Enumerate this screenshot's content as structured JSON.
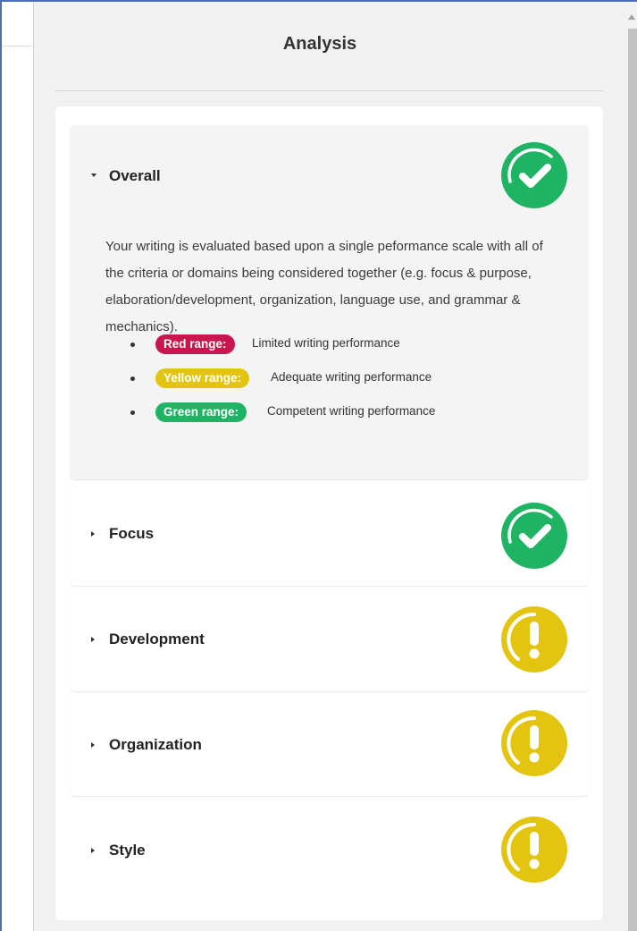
{
  "panel": {
    "title": "Analysis"
  },
  "sections": [
    {
      "label": "Overall",
      "expanded": true,
      "status": "competent",
      "status_icon": "check-circle-icon",
      "description": "Your writing is evaluated based upon a single peformance scale with all of the criteria or domains being considered together (e.g. focus & purpose, elaboration/development, organization, language use, and grammar & mechanics).",
      "legend": [
        {
          "badge": "Red range:",
          "text": "Limited writing performance",
          "color": "#c8174f"
        },
        {
          "badge": "Yellow range:",
          "text": "Adequate writing performance",
          "color": "#e3c511"
        },
        {
          "badge": "Green range:",
          "text": "Competent writing performance",
          "color": "#1fb464"
        }
      ]
    },
    {
      "label": "Focus",
      "expanded": false,
      "status": "competent",
      "status_icon": "check-circle-icon"
    },
    {
      "label": "Development",
      "expanded": false,
      "status": "adequate",
      "status_icon": "exclamation-circle-icon"
    },
    {
      "label": "Organization",
      "expanded": false,
      "status": "adequate",
      "status_icon": "exclamation-circle-icon"
    },
    {
      "label": "Style",
      "expanded": false,
      "status": "adequate",
      "status_icon": "exclamation-circle-icon"
    }
  ],
  "colors": {
    "green": "#1fb464",
    "yellow": "#e3c511",
    "red": "#c8174f",
    "panel_bg": "#f1f1f1",
    "frame": "#4a6fb5"
  }
}
